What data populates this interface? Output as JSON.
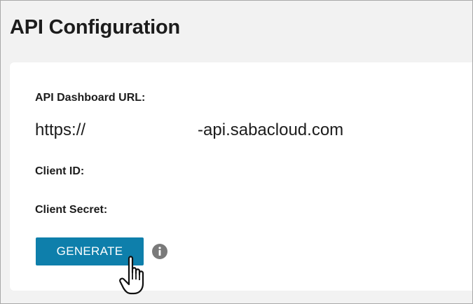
{
  "page": {
    "title": "API Configuration"
  },
  "fields": {
    "dashboard_url_label": "API Dashboard URL:",
    "dashboard_url_prefix": "https://",
    "dashboard_url_suffix": "-api.sabacloud.com",
    "client_id_label": "Client ID:",
    "client_secret_label": "Client Secret:"
  },
  "actions": {
    "generate_label": "GENERATE"
  },
  "icons": {
    "info": "info-icon",
    "cursor": "hand-pointer-cursor"
  },
  "colors": {
    "accent": "#0e7fab",
    "background": "#f2f2f2",
    "card": "#ffffff",
    "text": "#1c1c1c",
    "info_icon": "#7a7a7a"
  }
}
